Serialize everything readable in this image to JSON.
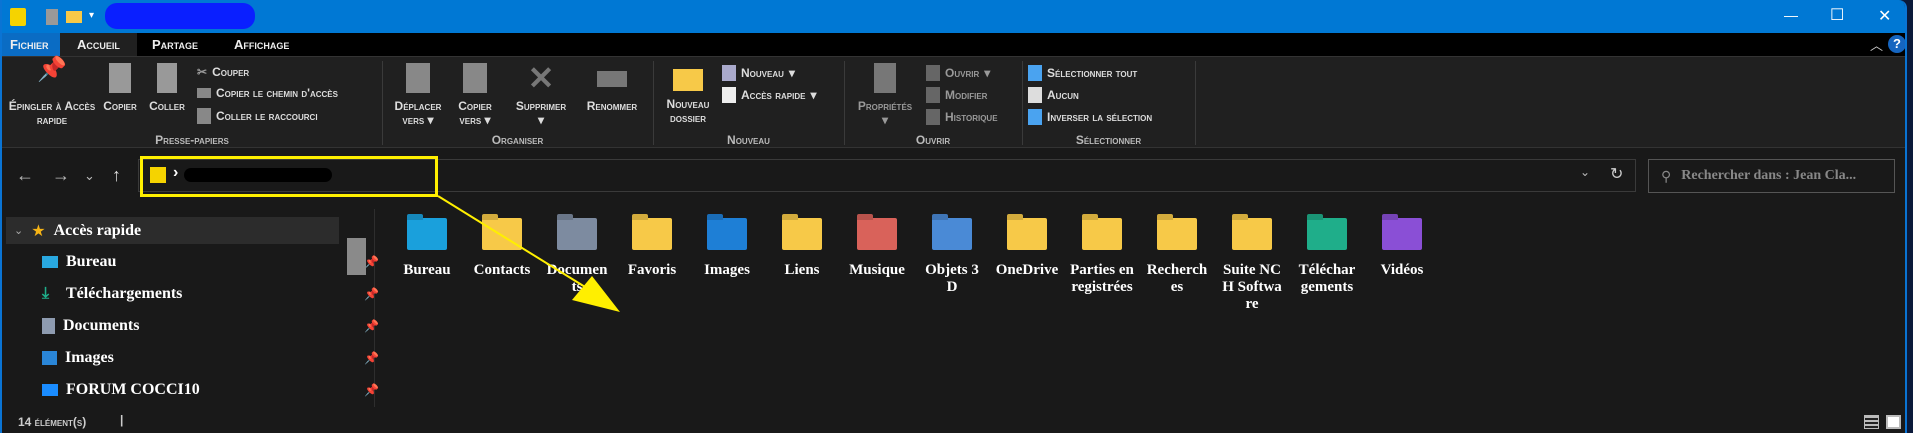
{
  "titlebar": {
    "minimize": "—",
    "maximize": "☐",
    "close": "✕"
  },
  "tabs": [
    "Fichier",
    "Accueil",
    "Partage",
    "Affichage"
  ],
  "ribbon": {
    "presse_papiers": {
      "label": "Presse-papiers",
      "pin": "Épingler à Accès rapide",
      "copy": "Copier",
      "paste": "Coller",
      "cut": "Couper",
      "copy_path": "Copier le chemin d'accès",
      "paste_shortcut": "Coller le raccourci"
    },
    "organiser": {
      "label": "Organiser",
      "move": "Déplacer vers",
      "copy_to": "Copier vers",
      "delete": "Supprimer",
      "rename": "Renommer"
    },
    "nouveau": {
      "label": "Nouveau",
      "new_folder": "Nouveau dossier",
      "new_item": "Nouveau",
      "easy_access": "Accès rapide"
    },
    "ouvrir": {
      "label": "Ouvrir",
      "properties": "Propriétés",
      "open": "Ouvrir",
      "edit": "Modifier",
      "history": "Historique"
    },
    "selectionner": {
      "label": "Sélectionner",
      "all": "Sélectionner tout",
      "none": "Aucun",
      "invert": "Inverser la sélection"
    }
  },
  "address": {
    "separator": "›"
  },
  "search": {
    "placeholder": "Rechercher dans : Jean Cla..."
  },
  "sidebar": {
    "header": "Accès rapide",
    "items": [
      {
        "label": "Bureau",
        "color": "#29a8e0"
      },
      {
        "label": "Téléchargements",
        "color": "#1fae8a"
      },
      {
        "label": "Documents",
        "color": "#8e9bb0"
      },
      {
        "label": "Images",
        "color": "#2a86d8"
      },
      {
        "label": "FORUM COCCI10",
        "color": "#1a8cff"
      }
    ]
  },
  "folders": [
    {
      "label": "Bureau",
      "color": "#1aa0dc"
    },
    {
      "label": "Contacts",
      "color": "#f7c948"
    },
    {
      "label": "Documents",
      "color": "#7d8ba0"
    },
    {
      "label": "Favoris",
      "color": "#f7c948"
    },
    {
      "label": "Images",
      "color": "#1e7fd6"
    },
    {
      "label": "Liens",
      "color": "#f7c948"
    },
    {
      "label": "Musique",
      "color": "#d9625a"
    },
    {
      "label": "Objets 3D",
      "color": "#4a8ad6"
    },
    {
      "label": "OneDrive",
      "color": "#f7c948"
    },
    {
      "label": "Parties enregistrées",
      "color": "#f7c948"
    },
    {
      "label": "Recherches",
      "color": "#f7c948"
    },
    {
      "label": "Suite NCH Software",
      "color": "#f7c948"
    },
    {
      "label": "Téléchargements",
      "color": "#1fae8a"
    },
    {
      "label": "Vidéos",
      "color": "#8a4fd6"
    }
  ],
  "status": {
    "count": "14 élément(s)"
  }
}
